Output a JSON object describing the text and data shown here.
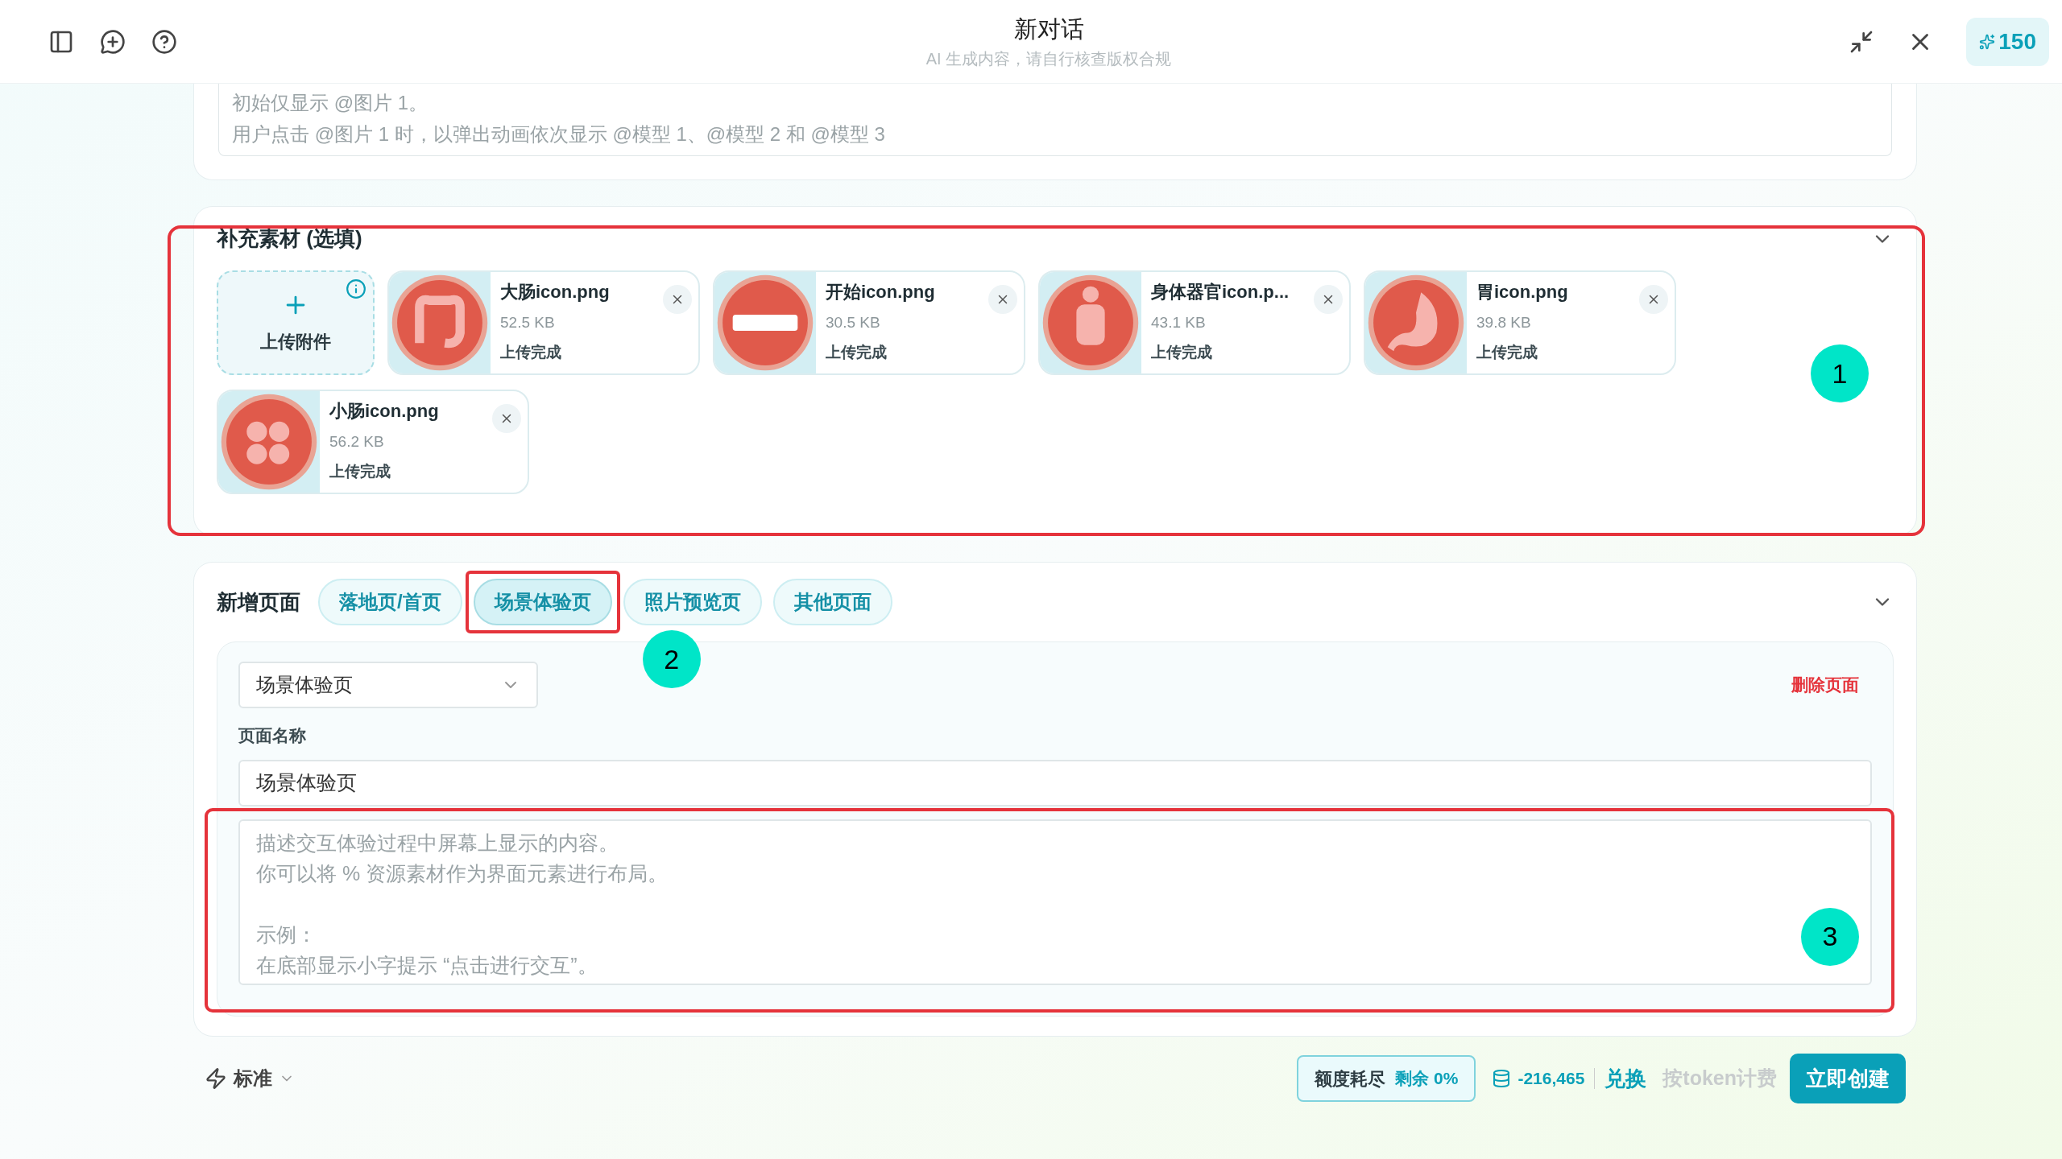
{
  "header": {
    "title": "新对话",
    "subtitle": "AI 生成内容，请自行核查版权合规",
    "credits": "150"
  },
  "prompt": {
    "placeholder_lines": [
      "初始仅显示 @图片 1。",
      "用户点击 @图片 1 时，以弹出动画依次显示 @模型 1、@模型 2 和 @模型 3"
    ]
  },
  "materials": {
    "title": "补充素材 (选填)",
    "marker": "1",
    "upload_label": "上传附件",
    "files": [
      {
        "name": "大肠icon.png",
        "size": "52.5 KB",
        "status": "上传完成"
      },
      {
        "name": "开始icon.png",
        "size": "30.5 KB",
        "status": "上传完成"
      },
      {
        "name": "身体器官icon.p...",
        "size": "43.1 KB",
        "status": "上传完成"
      },
      {
        "name": "胃icon.png",
        "size": "39.8 KB",
        "status": "上传完成"
      },
      {
        "name": "小肠icon.png",
        "size": "56.2 KB",
        "status": "上传完成"
      }
    ]
  },
  "pages": {
    "title": "新增页面",
    "tabs": [
      {
        "label": "落地页/首页",
        "selected": false
      },
      {
        "label": "场景体验页",
        "selected": true,
        "marker": "2"
      },
      {
        "label": "照片预览页",
        "selected": false
      },
      {
        "label": "其他页面",
        "selected": false
      }
    ],
    "page_select": "场景体验页",
    "delete_label": "删除页面",
    "name_label": "页面名称",
    "name_value": "场景体验页",
    "description": {
      "placeholder_paragraphs": [
        [
          "描述交互体验过程中屏幕上显示的内容。",
          "你可以将 % 资源素材作为界面元素进行布局。"
        ],
        [
          "示例：",
          "在底部显示小字提示 “点击进行交互”。"
        ]
      ],
      "marker": "3"
    }
  },
  "footer": {
    "mode": "标准",
    "quota_label": "额度耗尽",
    "quota_remaining": "剩余 0%",
    "balance": "-216,465",
    "exchange": "兑换",
    "billing": "按token计费",
    "create": "立即创建"
  }
}
